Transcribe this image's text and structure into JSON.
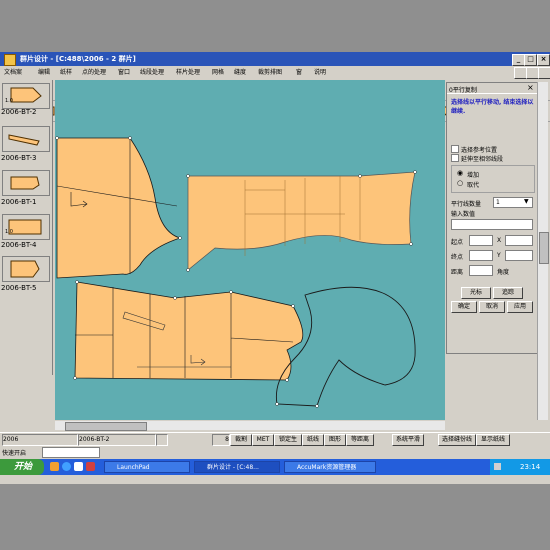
{
  "window": {
    "title": "群片设计 - [C:488\\2006  - 2 群片]",
    "min": "_",
    "max": "□",
    "close": "×"
  },
  "menu": [
    "文档案",
    "编辑",
    "纸样",
    "点的处理",
    "窗口",
    "线段处理",
    "样片处理",
    "网格",
    "缝度",
    "裁剪排图",
    "窗",
    "说明"
  ],
  "pieces": [
    {
      "label": "2006-BT-2",
      "size": "1.0"
    },
    {
      "label": "2006-BT-3",
      "size": ""
    },
    {
      "label": "2006-BT-1",
      "size": ""
    },
    {
      "label": "2006-BT-4",
      "size": "1.0"
    },
    {
      "label": "2006-BT-5",
      "size": ""
    }
  ],
  "panel": {
    "title": "0平行复制",
    "instruction": "选择线以平行移动, 结束选择以继续.",
    "check_ref": "选择参考位置",
    "check_extend": "延伸至相邻线段",
    "radio_add": "增加",
    "radio_replace": "取代",
    "count_label": "平行线数量",
    "count_value": "1",
    "input_label": "输入数值",
    "start_label": "起点",
    "end_label": "终点",
    "dist_label": "距离",
    "x_label": "X",
    "y_label": "Y",
    "angle_label": "角度",
    "btn_cursor": "光标",
    "btn_trace": "追踪",
    "btn_ok": "确定",
    "btn_cancel": "取消",
    "btn_apply": "应用"
  },
  "status": {
    "left": "2006",
    "piece": "2006-BT-2",
    "zoom": "8",
    "items": [
      "裁割",
      "MET",
      "锁定生",
      "纸线",
      "图形",
      "等距离",
      "系统平滑",
      "选择缝份线"
    ],
    "last": "显示纸线"
  },
  "quick_label": "快速开启",
  "taskbar": {
    "start": "开始",
    "tasks": [
      "LaunchPad",
      "群片设计 - [C:48...",
      "AccuMark资源管理器"
    ],
    "time": "23:14"
  },
  "colors": {
    "canvas": "#5fadb1",
    "piece": "#fdc47a",
    "titlebar": "#2a54b8"
  }
}
